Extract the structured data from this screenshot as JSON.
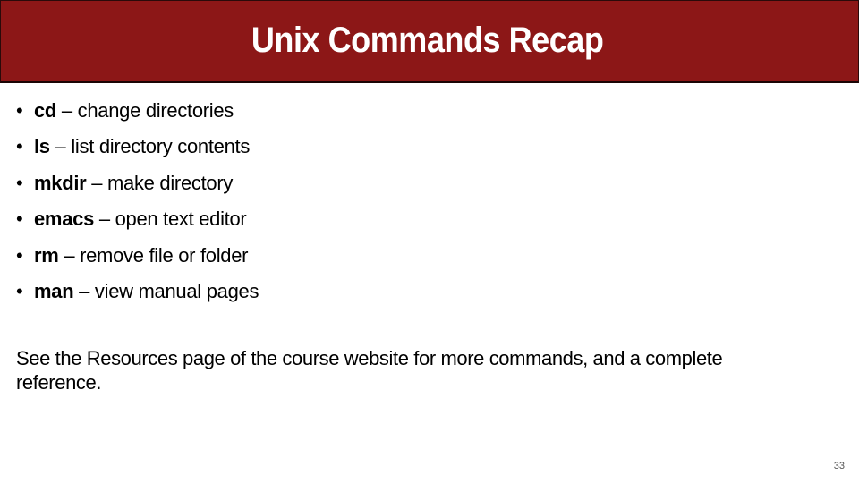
{
  "slide": {
    "title": "Unix Commands Recap",
    "bullets": [
      {
        "command": "cd",
        "separator": " – ",
        "description": "change directories"
      },
      {
        "command": "ls",
        "separator": " – ",
        "description": "list directory contents"
      },
      {
        "command": "mkdir",
        "separator": " – ",
        "description": "make directory"
      },
      {
        "command": "emacs",
        "separator": " – ",
        "description": "open text editor"
      },
      {
        "command": "rm",
        "separator": " – ",
        "description": "remove file or folder"
      },
      {
        "command": "man",
        "separator": " – ",
        "description": "view manual pages"
      }
    ],
    "bullet_glyph": "•",
    "note": "See the Resources page of the course website for more commands, and a complete reference.",
    "page_number": "33"
  },
  "colors": {
    "title_bar": "#8c1717",
    "title_text": "#ffffff",
    "body_text": "#000000"
  }
}
